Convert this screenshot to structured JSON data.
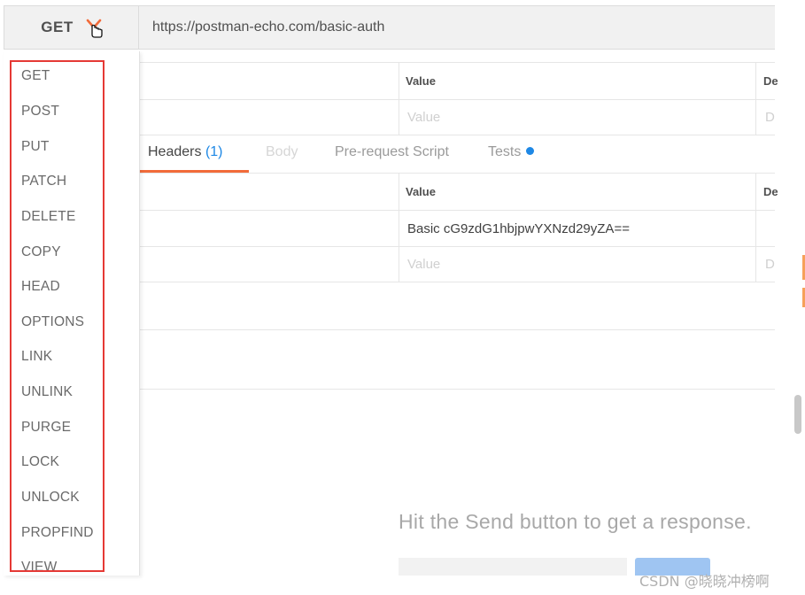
{
  "request": {
    "method": "GET",
    "url": "https://postman-echo.com/basic-auth"
  },
  "params_table": {
    "value_header": "Value",
    "desc_header_partial": "De",
    "value_placeholder": "Value",
    "desc_placeholder_partial": "D"
  },
  "tabs": [
    {
      "label": "Headers",
      "count": "(1)",
      "state": "active"
    },
    {
      "label": "Body",
      "state": "disabled"
    },
    {
      "label": "Pre-request Script",
      "state": "normal"
    },
    {
      "label": "Tests",
      "state": "normal",
      "indicator": "blue-dot"
    }
  ],
  "headers_table": {
    "value_header": "Value",
    "desc_header_partial": "De",
    "row1_value": "Basic cG9zdG1hbjpwYXNzd29yZA==",
    "value_placeholder": "Value",
    "desc_placeholder_partial": "D"
  },
  "method_menu": {
    "items": [
      "GET",
      "POST",
      "PUT",
      "PATCH",
      "DELETE",
      "COPY",
      "HEAD",
      "OPTIONS",
      "LINK",
      "UNLINK",
      "PURGE",
      "LOCK",
      "UNLOCK",
      "PROPFIND",
      "VIEW"
    ]
  },
  "response": {
    "hint": "Hit the Send button to get a response."
  },
  "watermark": "CSDN @晓晓冲榜啊",
  "colors": {
    "accent_orange": "#f26b3a",
    "accent_blue": "#1e88e5",
    "highlight_red": "#e53935"
  }
}
